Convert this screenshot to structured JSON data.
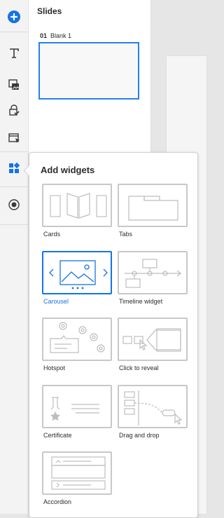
{
  "slides_panel": {
    "title": "Slides",
    "slides": [
      {
        "number": "01",
        "name": "Blank 1"
      }
    ]
  },
  "toolbar": {
    "tools": [
      "add-icon",
      "text-icon",
      "media-icon",
      "interactions-icon",
      "quiz-icon",
      "widgets-icon",
      "record-icon"
    ]
  },
  "widgets_panel": {
    "title": "Add widgets",
    "items": [
      {
        "label": "Cards"
      },
      {
        "label": "Tabs"
      },
      {
        "label": "Carousel"
      },
      {
        "label": "Timeline widget"
      },
      {
        "label": "Hotspot"
      },
      {
        "label": "Click to reveal"
      },
      {
        "label": "Certificate"
      },
      {
        "label": "Drag and drop"
      },
      {
        "label": "Accordion"
      }
    ],
    "selected": "Carousel"
  },
  "colors": {
    "accent": "#1473e6",
    "thumb_border": "#c8c8c8",
    "selection": "#2680eb"
  }
}
